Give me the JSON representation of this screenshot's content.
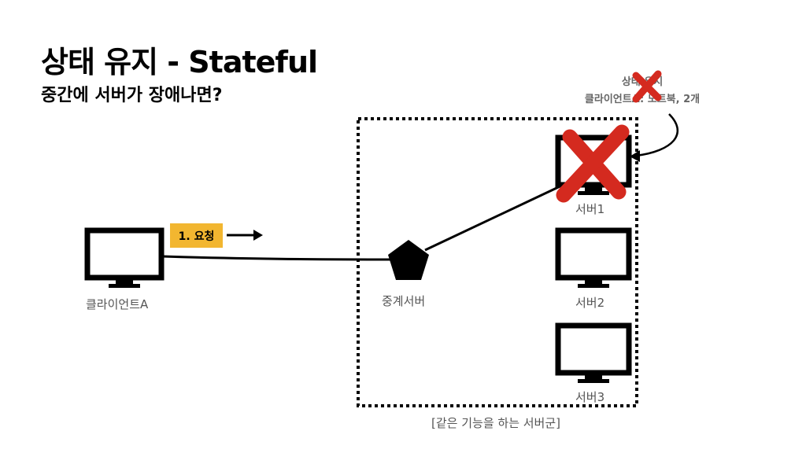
{
  "title": "상태 유지 - Stateful",
  "subtitle": "중간에 서버가 장애나면?",
  "client": {
    "label": "클라이언트A"
  },
  "request": {
    "label": "1. 요청"
  },
  "proxy": {
    "label": "중계서버"
  },
  "servers": [
    {
      "label": "서버1",
      "failed": true
    },
    {
      "label": "서버2",
      "failed": false
    },
    {
      "label": "서버3",
      "failed": false
    }
  ],
  "group": {
    "label": "[같은 기능을 하는 서버군]"
  },
  "state_note": {
    "line1": "상태 유지",
    "line2": "클라이언트A: 노트북, 2개"
  },
  "colors": {
    "accent": "#f2b630",
    "error": "#d42a1f",
    "stroke": "#000000"
  }
}
